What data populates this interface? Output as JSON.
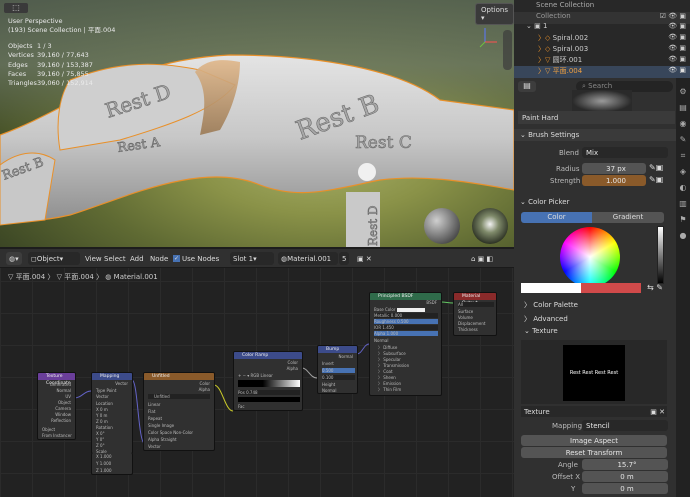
{
  "viewport": {
    "title": "User Perspective",
    "subtitle": "(193) Scene Collection | 平面.004",
    "stats": [
      {
        "label": "Objects",
        "value": "1 / 3"
      },
      {
        "label": "Vertices",
        "value": "39,160 / 77,643"
      },
      {
        "label": "Edges",
        "value": "39,160 / 153,387"
      },
      {
        "label": "Faces",
        "value": "39,160 / 75,855"
      },
      {
        "label": "Triangles",
        "value": "39,060 / 152,914"
      }
    ],
    "options_label": "Options",
    "model_labels": [
      "Rest D",
      "Rest A",
      "Rest B",
      "Rest C",
      "Rest B",
      "Rest D"
    ],
    "colors": {
      "selection": "#e8902a"
    }
  },
  "outliner": {
    "title": "Scene Collection",
    "collection": "Collection",
    "rows": [
      {
        "name": "1"
      },
      {
        "name": "Spiral.002"
      },
      {
        "name": "Spiral.003"
      },
      {
        "name": "圆环.001"
      },
      {
        "name": "平面.004"
      }
    ]
  },
  "properties": {
    "search_placeholder": "Search",
    "brush_name": "Paint Hard",
    "brush_settings": {
      "header": "Brush Settings",
      "blend_label": "Blend",
      "blend_value": "Mix",
      "radius_label": "Radius",
      "radius_value": "37 px",
      "strength_label": "Strength",
      "strength_value": "1.000"
    },
    "color_picker": {
      "header": "Color Picker",
      "tab_color": "Color",
      "tab_gradient": "Gradient",
      "swatch": "#d04a4a"
    },
    "panels": {
      "palette": "Color Palette",
      "advanced": "Advanced",
      "texture": "Texture"
    },
    "texture_preview_text": "Rest Rest Rest Rest",
    "texture": {
      "label": "Texture",
      "mapping_label": "Mapping",
      "mapping_value": "Stencil",
      "image_aspect": "Image Aspect",
      "reset_transform": "Reset Transform",
      "angle_label": "Angle",
      "angle_value": "15.7°",
      "offset_x_label": "Offset X",
      "offset_x_value": "0 m",
      "y_label": "Y",
      "y_value": "0 m",
      "z_label": "Z",
      "z_value": "0 m"
    }
  },
  "node_editor": {
    "header": {
      "mode": "Object",
      "menus": [
        "View",
        "Select",
        "Add",
        "Node"
      ],
      "use_nodes": "Use Nodes",
      "slot": "Slot 1",
      "material": "Material.001",
      "users": "5"
    },
    "breadcrumb": [
      "平面.004",
      "平面.004",
      "Material.001"
    ],
    "nodes": {
      "texcoord": {
        "title": "Texture Coordinate",
        "outputs": [
          "Generated",
          "Normal",
          "UV",
          "Object",
          "Camera",
          "Window",
          "Reflection"
        ],
        "object_label": "Object",
        "from_instancer": "From Instancer"
      },
      "mapping": {
        "title": "Mapping",
        "type": "Point",
        "outputs": [
          "Vector"
        ],
        "fields": [
          "Type",
          "Vector",
          "Location",
          "X",
          "Y",
          "Z",
          "Rotation",
          "X",
          "Y",
          "Z",
          "Scale",
          "X",
          "Y",
          "Z"
        ],
        "values": [
          "0 m",
          "0 m",
          "0 m",
          "0°",
          "0°",
          "0°",
          "1.000",
          "1.000",
          "1.000"
        ]
      },
      "image": {
        "title": "Unfitled",
        "image": "Unfitled",
        "options": [
          "Linear",
          "Flat",
          "Repeat",
          "Single Image"
        ],
        "colorspace_label": "Color Space",
        "colorspace": "Non-Color",
        "alpha_label": "Alpha",
        "alpha": "Straight",
        "outputs": [
          "Color",
          "Alpha"
        ],
        "inputs": [
          "Vector"
        ]
      },
      "ramp": {
        "title": "Color Ramp",
        "outputs": [
          "Color",
          "Alpha"
        ],
        "mode": "RGB",
        "interp": "Linear",
        "pos_label": "Pos",
        "pos": "0.748",
        "inputs": [
          "Fac"
        ]
      },
      "bump": {
        "title": "Bump",
        "outputs": [
          "Normal"
        ],
        "invert": "Invert",
        "strength": "0.500",
        "distance": "0.100",
        "inputs": [
          "Height",
          "Normal"
        ]
      },
      "bsdf": {
        "title": "Principled BSDF",
        "output": "BSDF",
        "fields": [
          "Base Color",
          "Metallic",
          "Roughness",
          "IOR",
          "Alpha",
          "Normal",
          "Diffuse",
          "Subsurface",
          "Specular",
          "Transmission",
          "Coat",
          "Sheen",
          "Emission",
          "Thin Film"
        ],
        "values": [
          "0.000",
          "0.500",
          "1.450",
          "1.000"
        ]
      },
      "output": {
        "title": "Material Output",
        "target": "All",
        "inputs": [
          "Surface",
          "Volume",
          "Displacement",
          "Thickness"
        ]
      }
    }
  }
}
